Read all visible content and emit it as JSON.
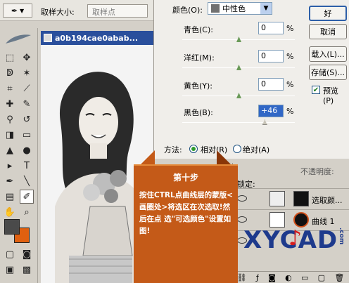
{
  "options_bar": {
    "sample_size_label": "取样大小:",
    "sample_size_value": "取样点"
  },
  "document": {
    "title": "a0b194cae0abab..."
  },
  "dialog": {
    "colors_label": "颜色(O):",
    "colors_value": "中性色",
    "sliders": [
      {
        "label": "青色(C):",
        "value": "0",
        "unit": "%",
        "level": 0.5
      },
      {
        "label": "洋红(M):",
        "value": "0",
        "unit": "%",
        "level": 0.5
      },
      {
        "label": "黄色(Y):",
        "value": "0",
        "unit": "%",
        "level": 0.5
      },
      {
        "label": "黑色(B):",
        "value": "+46",
        "unit": "%",
        "level": 0.73
      }
    ],
    "method_label": "方法:",
    "relative_label": "相对(R)",
    "absolute_label": "绝对(A)",
    "method_selected": "relative",
    "buttons": {
      "ok": "好",
      "cancel": "取消",
      "load": "载入(L)...",
      "save": "存储(S)...",
      "preview": "预览(P)"
    },
    "preview_checked": true
  },
  "layers": {
    "lock_label": "锁定:",
    "top_label": "不透明度:",
    "rows": [
      {
        "name": "选取颜..."
      },
      {
        "name": "曲线 1"
      },
      {
        "name": ""
      }
    ]
  },
  "callout": {
    "title": "第十步",
    "body": "按住CTRL点曲线层的蒙版<画圈处>将选区在次选取!然后在点 选\"可选颜色\"设置如图!"
  },
  "watermark": {
    "text": "XYCAD",
    "suffix": ".com"
  },
  "colors": {
    "foreground": "#4a4a4a",
    "background": "#e06010",
    "callout": "#c45a18",
    "highlight": "#3167c6"
  }
}
